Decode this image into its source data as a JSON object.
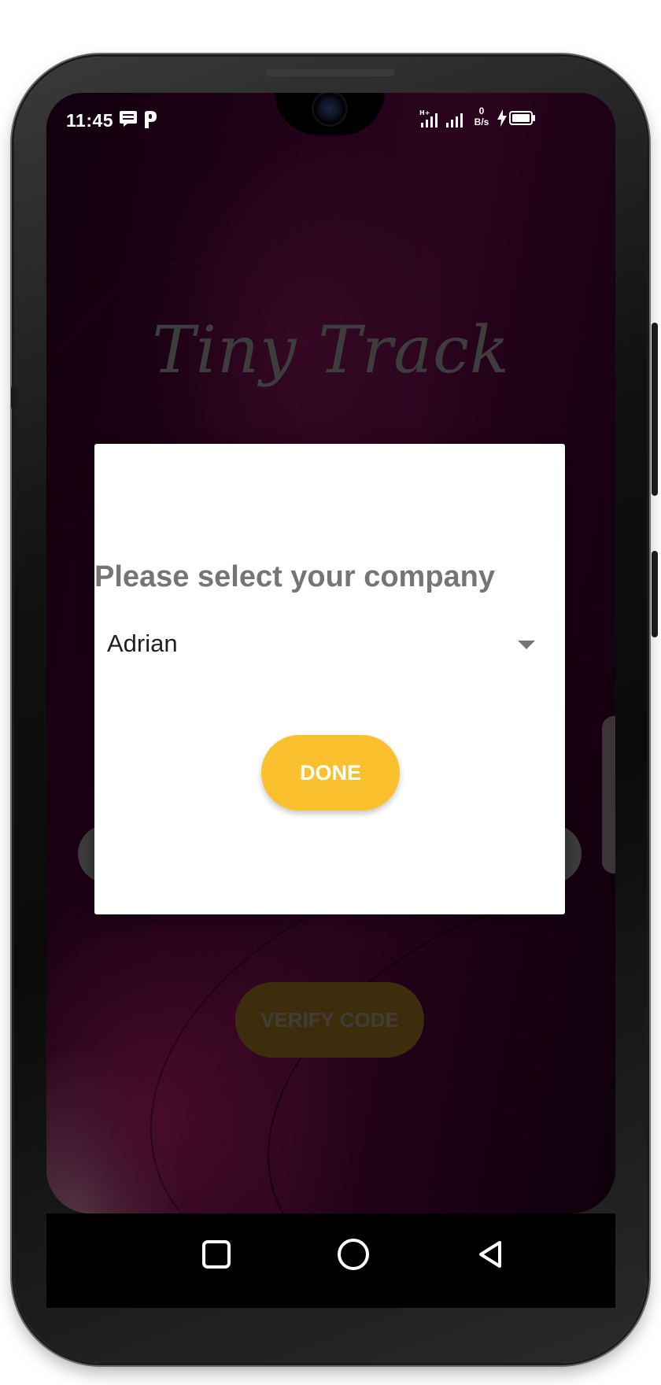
{
  "status_bar": {
    "time": "11:45",
    "network_speed_value": "0",
    "network_speed_unit": "B/s",
    "network_type": "H+",
    "icons": [
      "message-icon",
      "parking-icon",
      "signal-icon",
      "signal-icon",
      "charging-icon",
      "battery-icon"
    ]
  },
  "app": {
    "title": "Tiny Track",
    "verify_label": "VERIFY CODE"
  },
  "dialog": {
    "title": "Please select your company",
    "selected_company": "Adrian",
    "done_label": "DONE"
  },
  "colors": {
    "accent": "#fbc02d",
    "wallpaper": "#4a0834",
    "dialog_title": "#757575"
  },
  "nav": {
    "icons": [
      "recent-apps-icon",
      "home-icon",
      "back-icon"
    ]
  }
}
